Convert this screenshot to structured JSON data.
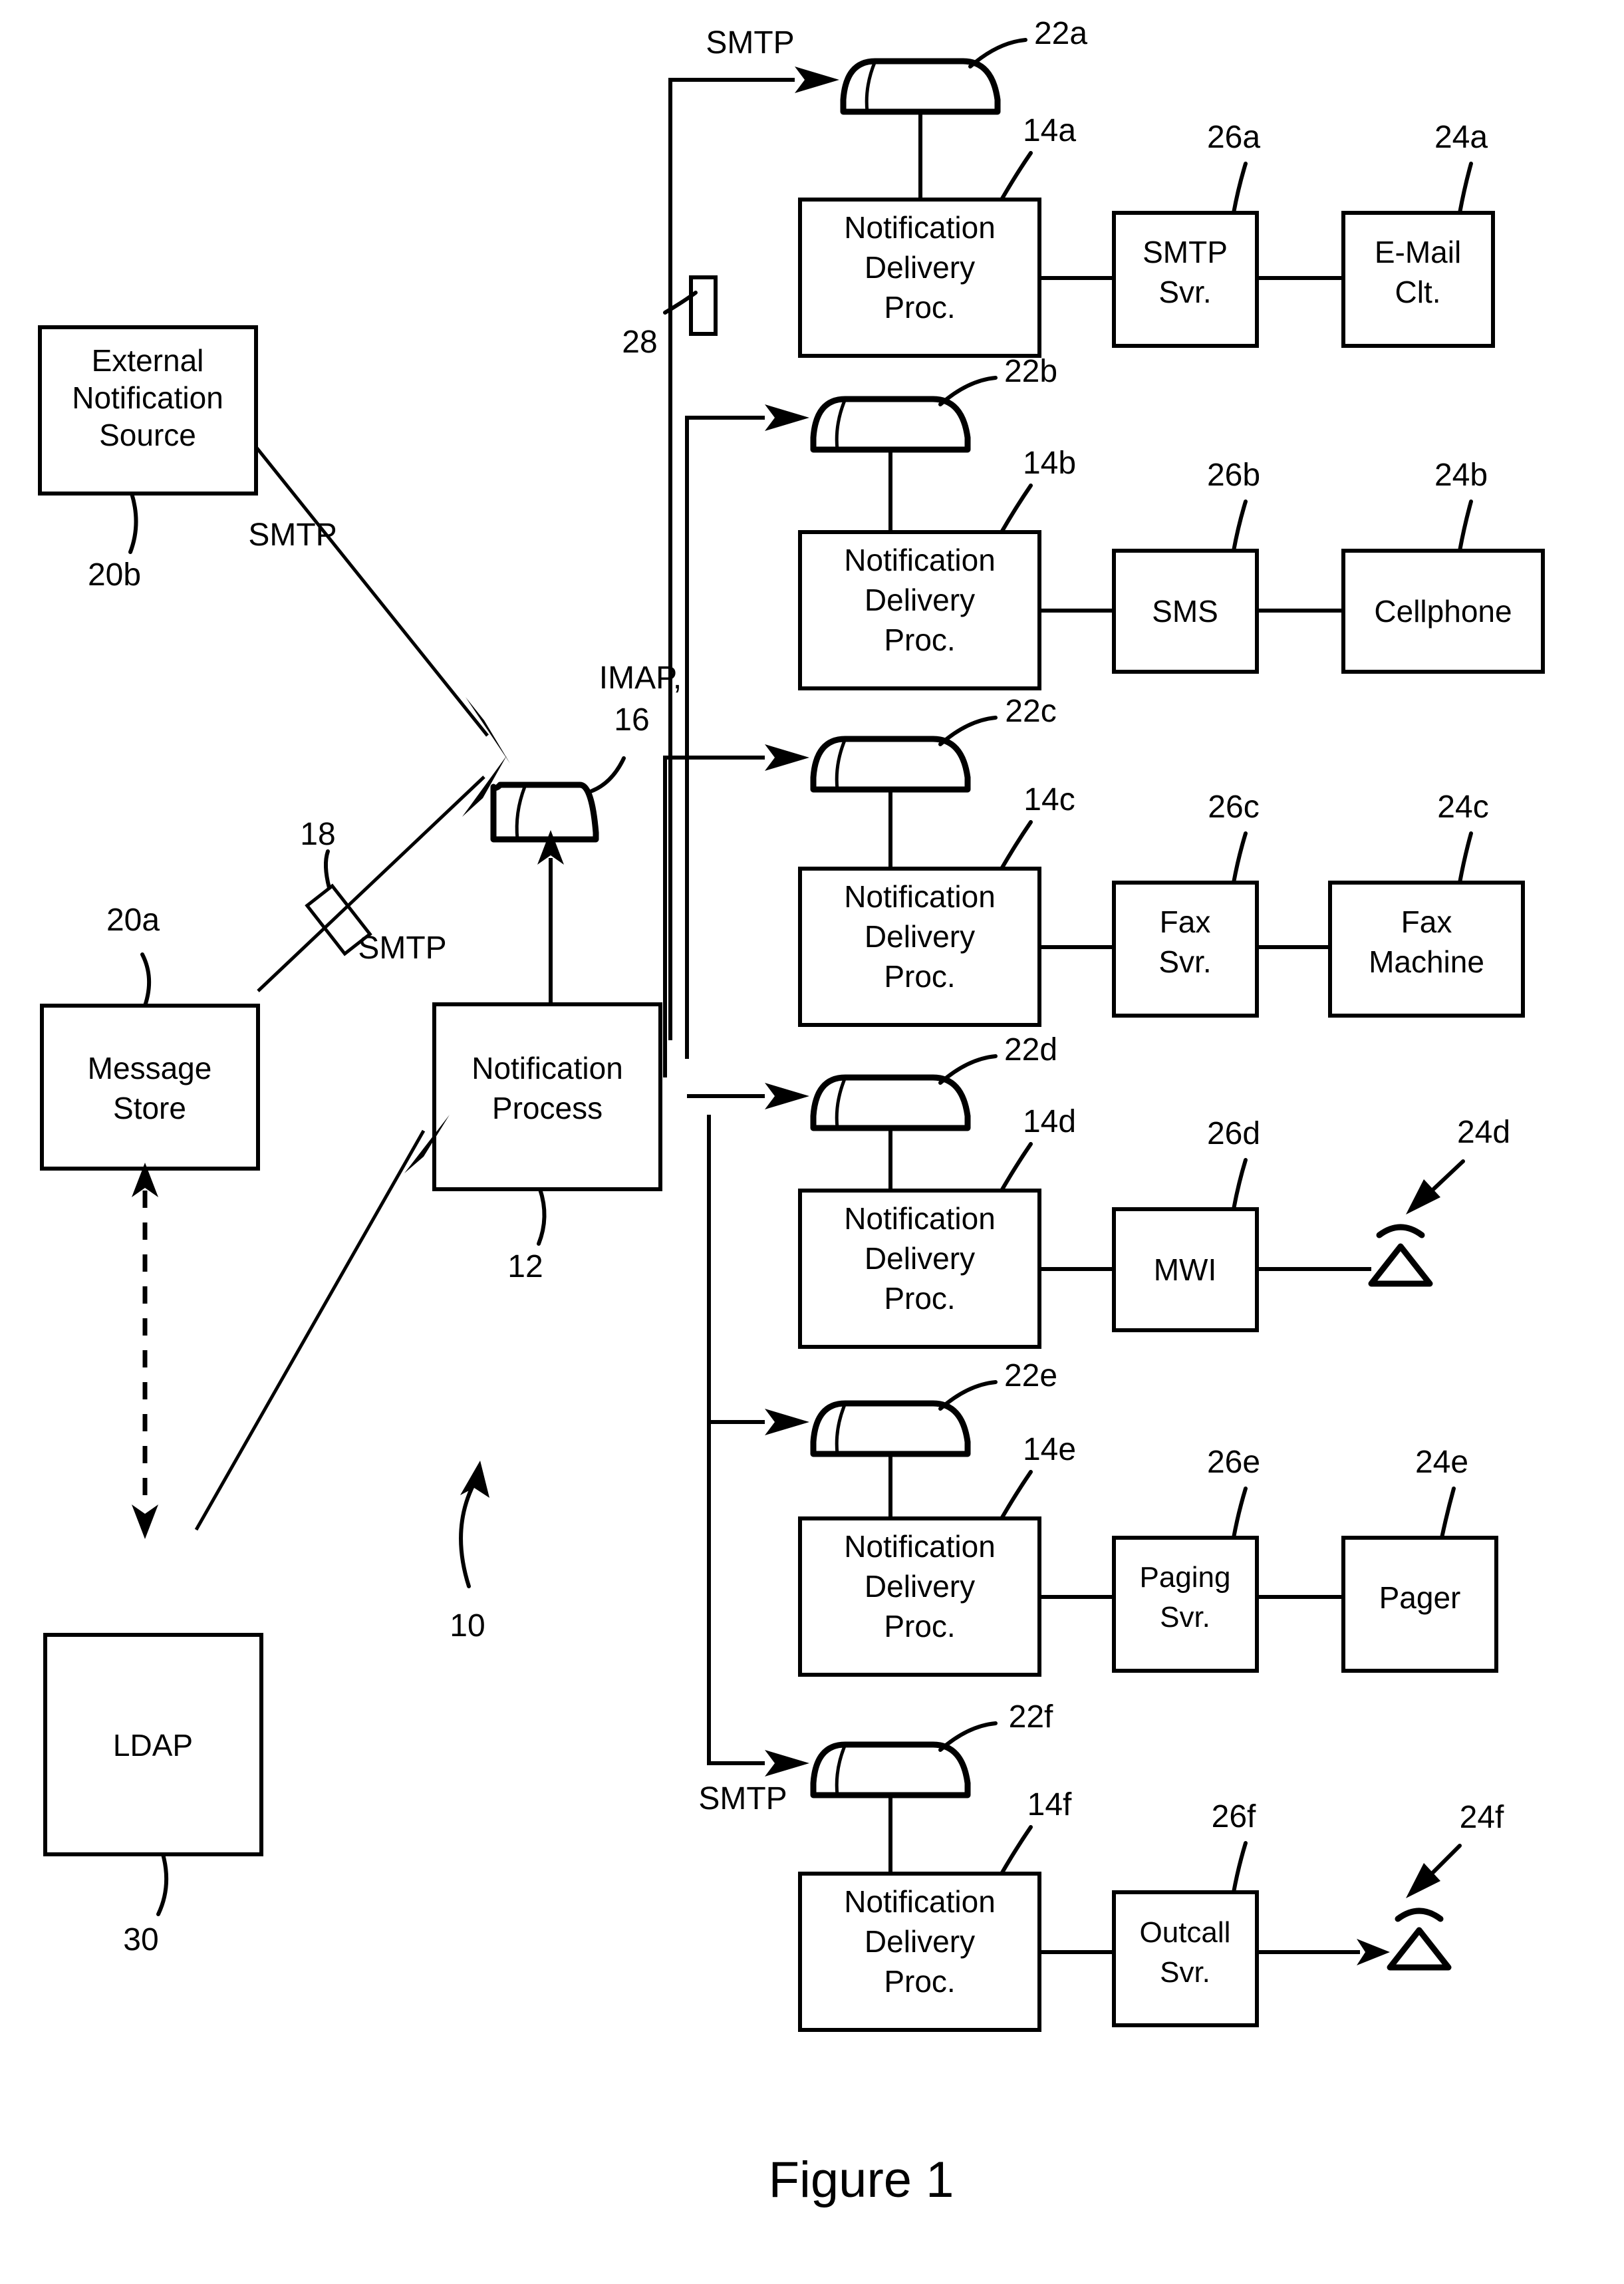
{
  "figure": {
    "caption": "Figure 1",
    "system_ref": "10"
  },
  "left_column": {
    "external_notification_source": {
      "line1": "External",
      "line2": "Notification",
      "line3": "Source",
      "ref": "20b"
    },
    "message_store": {
      "line1": "Message",
      "line2": "Store",
      "ref": "20a"
    },
    "ldap": {
      "label": "LDAP",
      "ref": "30"
    },
    "connector_18_ref": "18"
  },
  "center": {
    "notification_process": {
      "line1": "Notification",
      "line2": "Process",
      "ref": "12"
    },
    "imap_queue": {
      "protocol": "IMAP,",
      "ref": "16"
    },
    "smtp_from_external": "SMTP",
    "smtp_from_message_store": "SMTP",
    "connector_28_ref": "28"
  },
  "protocol_labels": {
    "top_smtp": "SMTP",
    "bottom_smtp": "SMTP"
  },
  "delivery_rows": [
    {
      "queue_ref": "22a",
      "ndp": {
        "line1": "Notification",
        "line2": "Delivery",
        "line3": "Proc.",
        "ref": "14a"
      },
      "server": {
        "line1": "SMTP",
        "line2": "Svr.",
        "ref": "26a"
      },
      "endpoint": {
        "line1": "E-Mail",
        "line2": "Clt.",
        "ref": "24a",
        "type": "box"
      }
    },
    {
      "queue_ref": "22b",
      "ndp": {
        "line1": "Notification",
        "line2": "Delivery",
        "line3": "Proc.",
        "ref": "14b"
      },
      "server": {
        "line1": "SMS",
        "line2": "",
        "ref": "26b"
      },
      "endpoint": {
        "line1": "Cellphone",
        "line2": "",
        "ref": "24b",
        "type": "box"
      }
    },
    {
      "queue_ref": "22c",
      "ndp": {
        "line1": "Notification",
        "line2": "Delivery",
        "line3": "Proc.",
        "ref": "14c"
      },
      "server": {
        "line1": "Fax",
        "line2": "Svr.",
        "ref": "26c"
      },
      "endpoint": {
        "line1": "Fax",
        "line2": "Machine",
        "ref": "24c",
        "type": "box"
      }
    },
    {
      "queue_ref": "22d",
      "ndp": {
        "line1": "Notification",
        "line2": "Delivery",
        "line3": "Proc.",
        "ref": "14d"
      },
      "server": {
        "line1": "MWI",
        "line2": "",
        "ref": "26d"
      },
      "endpoint": {
        "line1": "",
        "line2": "",
        "ref": "24d",
        "type": "lamp"
      }
    },
    {
      "queue_ref": "22e",
      "ndp": {
        "line1": "Notification",
        "line2": "Delivery",
        "line3": "Proc.",
        "ref": "14e"
      },
      "server": {
        "line1": "Paging",
        "line2": "Svr.",
        "ref": "26e"
      },
      "endpoint": {
        "line1": "Pager",
        "line2": "",
        "ref": "24e",
        "type": "box"
      }
    },
    {
      "queue_ref": "22f",
      "ndp": {
        "line1": "Notification",
        "line2": "Delivery",
        "line3": "Proc.",
        "ref": "14f"
      },
      "server": {
        "line1": "Outcall",
        "line2": "Svr.",
        "ref": "26f"
      },
      "endpoint": {
        "line1": "",
        "line2": "",
        "ref": "24f",
        "type": "lamp"
      }
    }
  ],
  "colors": {
    "ink": "#000000",
    "paper": "#ffffff"
  }
}
